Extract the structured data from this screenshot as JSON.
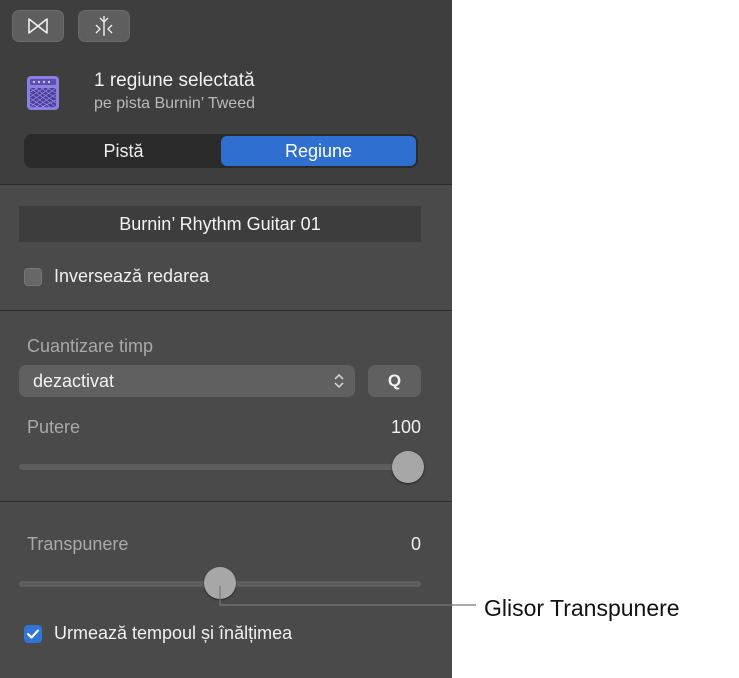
{
  "toolbar": {
    "button1_icon": "marquee-bowtie-icon",
    "button2_icon": "split-playhead-icon"
  },
  "header": {
    "icon": "amp-icon",
    "title": "1 regiune selectată",
    "subtitle": "pe pista Burnin’ Tweed"
  },
  "tabs": [
    {
      "label": "Pistă",
      "active": false
    },
    {
      "label": "Regiune",
      "active": true
    }
  ],
  "region": {
    "name": "Burnin’ Rhythm Guitar 01",
    "reverse_label": "Inversează redarea",
    "reverse_checked": false
  },
  "quantize": {
    "label": "Cuantizare timp",
    "value": "dezactivat",
    "q_button": "Q"
  },
  "strength": {
    "label": "Putere",
    "value": "100",
    "fraction": 1.0
  },
  "transpose": {
    "label": "Transpunere",
    "value": "0",
    "fraction": 0.5
  },
  "follow": {
    "label": "Urmează tempoul și înălțimea",
    "checked": true
  },
  "callout": {
    "label": "Glisor Transpunere"
  },
  "colors": {
    "accent": "#2f6fcf",
    "panel": "#4a4a4a",
    "amp_icon": "#8b7fe0"
  }
}
